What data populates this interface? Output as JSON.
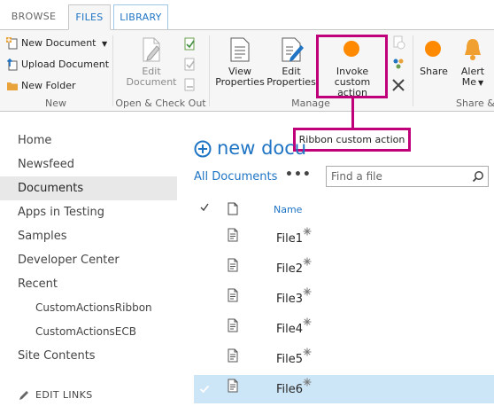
{
  "tabs": {
    "browse": "BROWSE",
    "files": "FILES",
    "library": "LIBRARY"
  },
  "ribbon": {
    "new_group": {
      "new_document": "New Document",
      "upload_document": "Upload Document",
      "new_folder": "New Folder",
      "label": "New"
    },
    "open_group": {
      "edit_document_line1": "Edit",
      "edit_document_line2": "Document",
      "label": "Open & Check Out"
    },
    "manage_group": {
      "view_properties_line1": "View",
      "view_properties_line2": "Properties",
      "edit_properties_line1": "Edit",
      "edit_properties_line2": "Properties",
      "invoke_line1": "Invoke custom",
      "invoke_line2": "action",
      "label": "Manage"
    },
    "share_group": {
      "share": "Share",
      "alert_line1": "Alert",
      "alert_line2": "Me",
      "label": "Share &"
    },
    "accent_color": "#ff8a00"
  },
  "callout": {
    "text": "Ribbon custom action",
    "color": "#c0007a"
  },
  "leftnav": {
    "items": [
      {
        "label": "Home"
      },
      {
        "label": "Newsfeed"
      },
      {
        "label": "Documents"
      },
      {
        "label": "Apps in Testing"
      },
      {
        "label": "Samples"
      },
      {
        "label": "Developer Center"
      },
      {
        "label": "Recent"
      },
      {
        "label": "CustomActionsRibbon"
      },
      {
        "label": "CustomActionsECB"
      },
      {
        "label": "Site Contents"
      }
    ],
    "edit_links": "EDIT LINKS"
  },
  "main": {
    "new_document": "new docu",
    "view_name": "All Documents",
    "ellipsis": "•••",
    "search_placeholder": "Find a file",
    "column_name": "Name",
    "files": [
      "File1",
      "File2",
      "File3",
      "File4",
      "File5",
      "File6"
    ],
    "selected_file": "File6",
    "link_color": "#1f74c4",
    "selection_color": "#cde6f7"
  }
}
